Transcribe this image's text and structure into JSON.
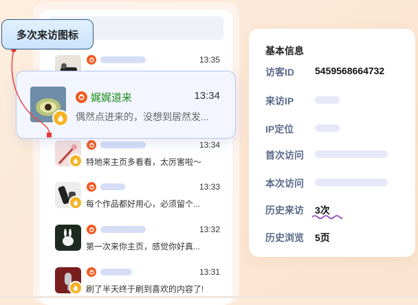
{
  "callout": {
    "label": "多次来访图标"
  },
  "highlight": {
    "name": "娓娓道来",
    "time": "13:34",
    "message": "偶然点进来的，没想到居然发..."
  },
  "rows": [
    {
      "time": "13:35",
      "message": ""
    },
    {
      "time": "13:34",
      "message": "特地来主页多看看，太厉害啦～"
    },
    {
      "time": "13:33",
      "message": "每个作品都好用心，必须留个..."
    },
    {
      "time": "13:32",
      "message": "第一次来你主页，感觉你好真..."
    },
    {
      "time": "13:31",
      "message": "刷了半天终于刷到喜欢的内容了!"
    }
  ],
  "info": {
    "title": "基本信息",
    "visitor_id_label": "访客ID",
    "visitor_id_value": "5459568664732",
    "ip_label": "来访IP",
    "ip_location_label": "IP定位",
    "first_visit_label": "首次访问",
    "this_visit_label": "本次访问",
    "history_visits_label": "历史来访",
    "history_visits_value": "3次",
    "history_browse_label": "历史浏览",
    "history_browse_value": "5页"
  },
  "colors": {
    "background": "#fde9d8",
    "accent_orange": "#f15a22",
    "badge_yellow": "#f5b325",
    "name_green": "#1f8a1f",
    "callout_dot": "#e53935"
  }
}
